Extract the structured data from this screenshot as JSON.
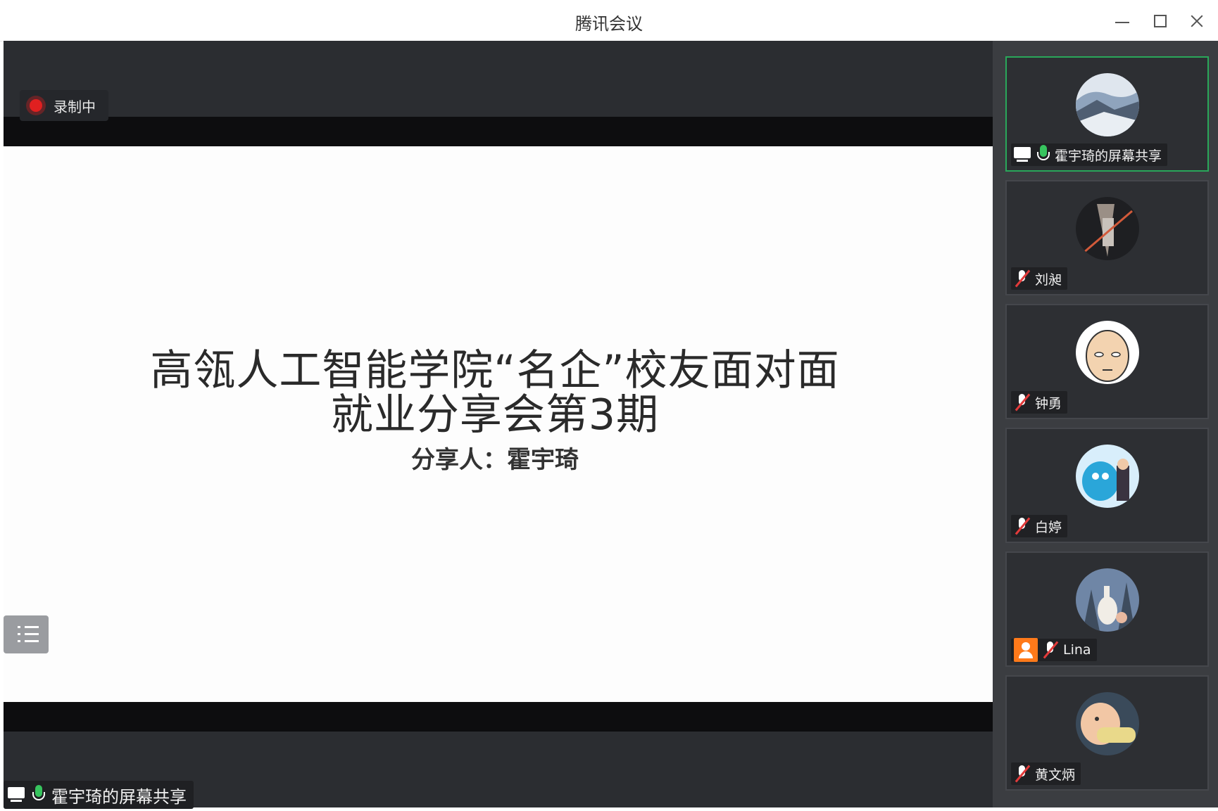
{
  "window": {
    "title": "腾讯会议"
  },
  "recording": {
    "label": "录制中"
  },
  "slide": {
    "title_line1": "高瓴人工智能学院“名企”校友面对面",
    "title_line2": "就业分享会第3期",
    "presenter": "分享人：霍宇琦"
  },
  "main_label": {
    "text": "霍宇琦的屏幕共享"
  },
  "participants": [
    {
      "name": "霍宇琦的屏幕共享",
      "mic": "on",
      "sharing": true,
      "active": true
    },
    {
      "name": "刘昶",
      "mic": "off"
    },
    {
      "name": "钟勇",
      "mic": "off"
    },
    {
      "name": "白婷",
      "mic": "off"
    },
    {
      "name": "Lina",
      "mic": "off",
      "host": true
    },
    {
      "name": "黄文炳",
      "mic": "off"
    }
  ],
  "colors": {
    "accent_green": "#29a75a",
    "record_red": "#e02020",
    "host_orange": "#ff7a1a"
  }
}
